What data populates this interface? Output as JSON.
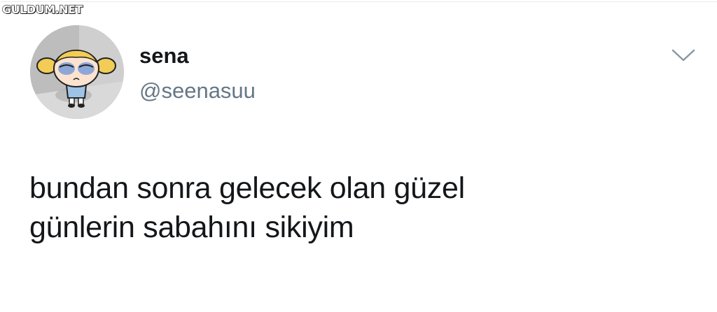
{
  "watermark": "GULDUM.NET",
  "tweet": {
    "author": {
      "display_name": "sena",
      "handle": "@seenasuu",
      "avatar_icon": "cartoon-girl-avatar"
    },
    "menu_icon": "chevron-down-icon",
    "text_lines": [
      "bundan sonra gelecek olan güzel",
      "günlerin sabahını sikiyim"
    ]
  },
  "colors": {
    "background": "#ffffff",
    "text_primary": "#14171a",
    "text_secondary": "#657786",
    "chevron": "#8899a6"
  }
}
